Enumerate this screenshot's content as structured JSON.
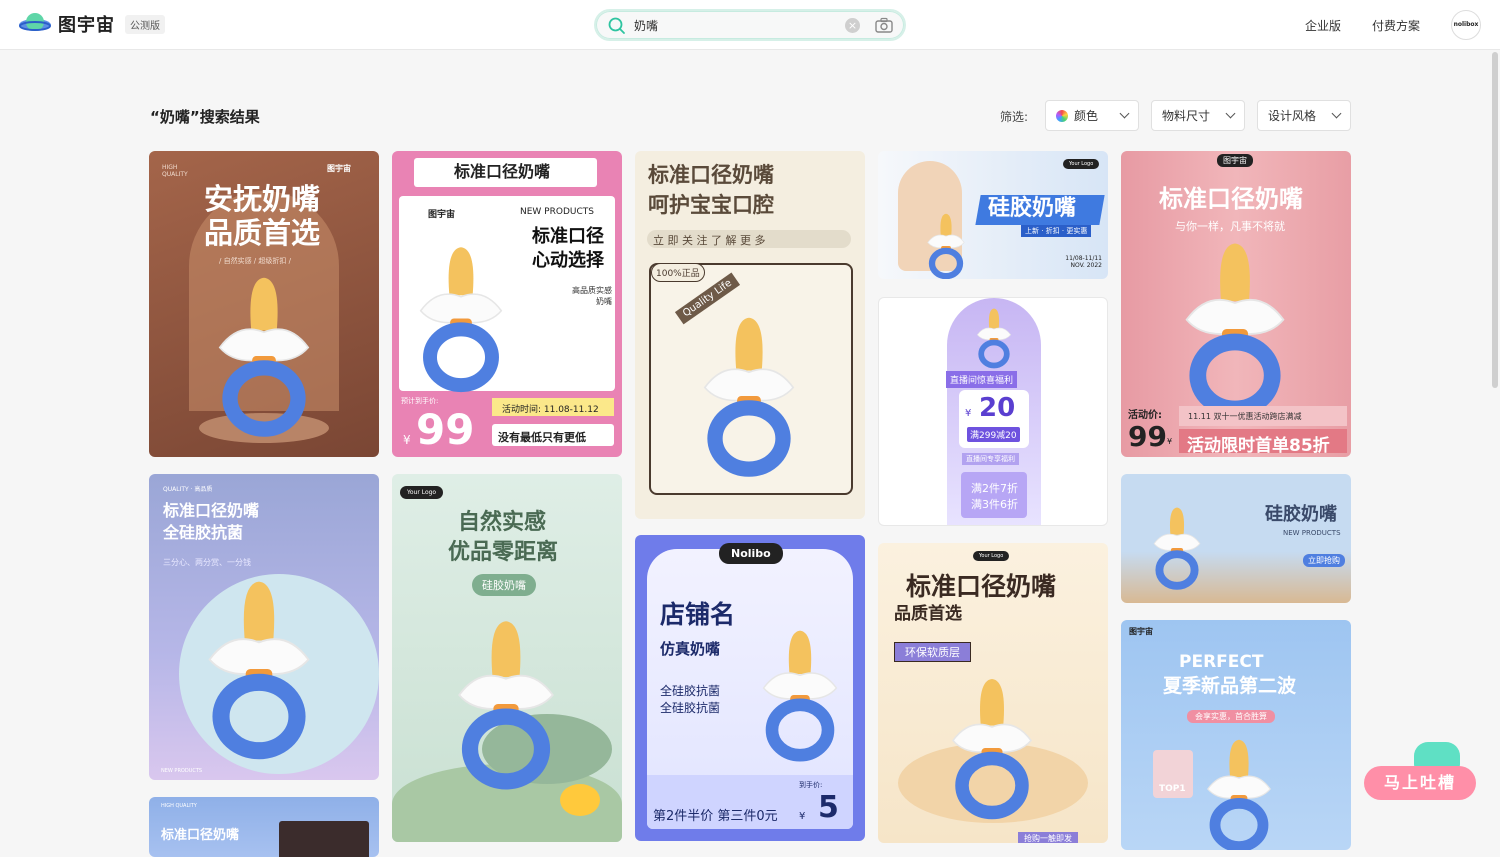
{
  "header": {
    "logo_text": "图宇宙",
    "beta_badge": "公测版",
    "search": {
      "value": "奶嘴",
      "placeholder": ""
    },
    "nav": [
      "企业版",
      "付费方案"
    ],
    "avatar_text": "nolibox"
  },
  "results": {
    "title": "“奶嘴”搜索结果",
    "filter_label": "筛选:",
    "filters": [
      "颜色",
      "物料尺寸",
      "设计风格"
    ]
  },
  "colors": {
    "accent": "#2ec4a0",
    "brand_blue": "#3f7ae0"
  },
  "cards": [
    {
      "lines": [
        "安抚奶嘴",
        "品质首选"
      ],
      "small": "HIGH QUALITY",
      "tag": "/ 自然实感 / 超级折扣 /",
      "logo": "图宇宙"
    },
    {
      "header": "标准口径奶嘴",
      "lines": [
        "标准口径",
        "心动选择"
      ],
      "new": "NEW PRODUCTS",
      "logo": "图宇宙",
      "sub": "高品质实感奶嘴",
      "price_label": "预计到手价:",
      "price": "99",
      "currency": "¥",
      "time": "活动时间: 11.08-11.12",
      "slogan": "没有最低只有更低"
    },
    {
      "lines": [
        "标准口径奶嘴",
        "呵护宝宝口腔"
      ],
      "follow": "立 即 关 注   了 解 更 多",
      "stamp": "100%正品",
      "quality": "Quality Life"
    },
    {
      "title": "硅胶奶嘴",
      "sub": "上新 · 折扣 · 更实惠",
      "date": "11/08-11/11 NOV. 2022",
      "logo": "Your Logo"
    },
    {
      "banner": "直播间惊喜福利",
      "currency": "¥",
      "amount": "20",
      "deal": "满299减20",
      "deal2": "直播间专享福利",
      "deal3a": "满2件7折",
      "deal3b": "满3件6折"
    },
    {
      "title": "标准口径奶嘴",
      "sub": "与你一样，凡事不将就",
      "logo": "图宇宙",
      "price_label": "活动价:",
      "price": "99",
      "currency": "¥",
      "event": "11.11 双十一优惠活动跨店满减",
      "slogan": "活动限时首单85折"
    },
    {
      "lines": [
        "标准口径奶嘴",
        "全硅胶抗菌"
      ],
      "small": "QUALITY · 高品质",
      "desc": "三分心、两分赏、一分钱",
      "foot": "NEW PRODUCTS"
    },
    {
      "lines": [
        "自然实感",
        "优品零距离"
      ],
      "pill": "硅胶奶嘴",
      "logo": "Your Logo"
    },
    {
      "brand": "Nolibo",
      "title": "店铺名",
      "sub": "仿真奶嘴",
      "desc1": "全硅胶抗菌",
      "desc2": "全硅胶抗菌",
      "price_label": "到手价:",
      "price": "5",
      "currency": "¥",
      "promo": "第2件半价 第三件0元"
    },
    {
      "title": "硅胶奶嘴",
      "new": "NEW PRODUCTS",
      "btn": "立即抢购"
    },
    {
      "title": "标准口径奶嘴",
      "sub": "品质首选",
      "badge": "环保软质层",
      "logo": "Your Logo",
      "btn": "抢购一触即发"
    },
    {
      "lines": [
        "PERFECT",
        "夏季新品第二波"
      ],
      "logo": "图宇宙",
      "tag": "会享实惠，首合胜算",
      "top": "TOP1"
    },
    {
      "lines": [
        "标准口径奶嘴"
      ],
      "small": "HIGH QUALITY"
    }
  ],
  "feedback": {
    "label": "马上吐槽"
  }
}
